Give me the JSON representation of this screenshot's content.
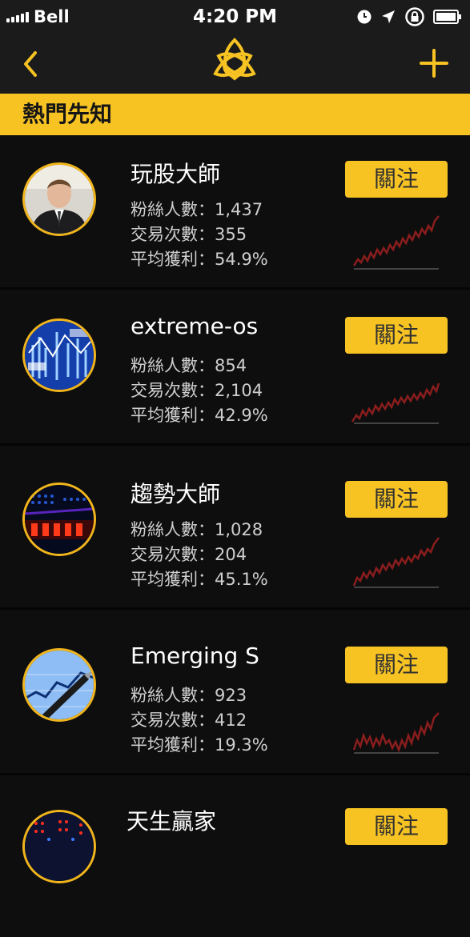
{
  "status": {
    "carrier": "Bell",
    "time": "4:20 PM"
  },
  "nav": {
    "logo": "trinity-logo"
  },
  "section": {
    "title": "熱門先知"
  },
  "labels": {
    "fans": "粉絲人數：",
    "trades": "交易次數：",
    "avg_profit": "平均獲利："
  },
  "traders": [
    {
      "name": "玩股大師",
      "fans": "1,437",
      "trades": "355",
      "avg_profit": "54.9%",
      "follow": "關注",
      "avatar": "man-in-suit"
    },
    {
      "name": "extreme-os",
      "fans": "854",
      "trades": "2,104",
      "avg_profit": "42.9%",
      "follow": "關注",
      "avatar": "blue-market-board"
    },
    {
      "name": "趨勢大師",
      "fans": "1,028",
      "trades": "204",
      "avg_profit": "45.1%",
      "follow": "關注",
      "avatar": "led-ticker"
    },
    {
      "name": "Emerging S",
      "fans": "923",
      "trades": "412",
      "avg_profit": "19.3%",
      "follow": "關注",
      "avatar": "chart-and-pen"
    },
    {
      "name": "天生贏家",
      "follow": "關注",
      "avatar": "red-ticker"
    }
  ],
  "colors": {
    "accent": "#f7c323",
    "spark": "#8a1d1d",
    "background": "#0e0e0e",
    "bar": "#1b1b1b"
  }
}
